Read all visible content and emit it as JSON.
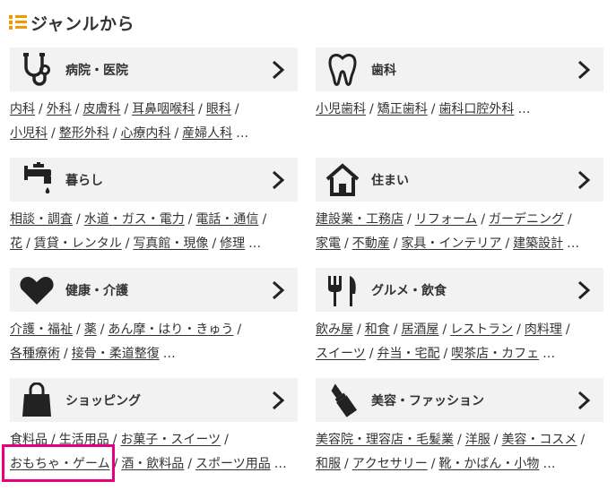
{
  "heading": {
    "title": "ジャンルから",
    "icon": "list-icon",
    "accent": "#f39800"
  },
  "categories": [
    {
      "label": "病院・医院",
      "icon": "stethoscope-icon",
      "line1": [
        {
          "text": "内科"
        },
        {
          "text": "外科"
        },
        {
          "text": "皮膚科"
        },
        {
          "text": "耳鼻咽喉科"
        },
        {
          "text": "眼科"
        }
      ],
      "line2": [
        {
          "text": "小児科"
        },
        {
          "text": "整形外科"
        },
        {
          "text": "心療内科"
        },
        {
          "text": "産婦人科"
        }
      ],
      "more": "…"
    },
    {
      "label": "歯科",
      "icon": "tooth-icon",
      "line1": [
        {
          "text": "小児歯科"
        },
        {
          "text": "矯正歯科"
        },
        {
          "text": "歯科口腔外科"
        }
      ],
      "line2": [],
      "more": "…"
    },
    {
      "label": "暮らし",
      "icon": "faucet-icon",
      "line1": [
        {
          "text": "相談・調査"
        },
        {
          "text": "水道・ガス・電力"
        },
        {
          "text": "電話・通信"
        }
      ],
      "line2": [
        {
          "text": "花"
        },
        {
          "text": "賃貸・レンタル"
        },
        {
          "text": "写真館・現像"
        },
        {
          "text": "修理"
        }
      ],
      "more": "…"
    },
    {
      "label": "住まい",
      "icon": "house-icon",
      "line1": [
        {
          "text": "建設業・工務店"
        },
        {
          "text": "リフォーム"
        },
        {
          "text": "ガーデニング"
        }
      ],
      "line2": [
        {
          "text": "家電"
        },
        {
          "text": "不動産"
        },
        {
          "text": "家具・インテリア"
        },
        {
          "text": "建築設計"
        }
      ],
      "more": "…"
    },
    {
      "label": "健康・介護",
      "icon": "heart-icon",
      "line1": [
        {
          "text": "介護・福祉"
        },
        {
          "text": "薬"
        },
        {
          "text": "あん摩・はり・きゅう"
        }
      ],
      "line2": [
        {
          "text": "各種療術"
        },
        {
          "text": "接骨・柔道整復"
        }
      ],
      "more": "…"
    },
    {
      "label": "グルメ・飲食",
      "icon": "fork-knife-icon",
      "line1": [
        {
          "text": "飲み屋"
        },
        {
          "text": "和食"
        },
        {
          "text": "居酒屋"
        },
        {
          "text": "レストラン"
        },
        {
          "text": "肉料理"
        }
      ],
      "line2": [
        {
          "text": "スイーツ"
        },
        {
          "text": "弁当・宅配"
        },
        {
          "text": "喫茶店・カフェ"
        }
      ],
      "more": "…"
    },
    {
      "label": "ショッピング",
      "icon": "shopping-bag-icon",
      "line1": [
        {
          "text": "食料品"
        },
        {
          "text": "生活用品"
        },
        {
          "text": "お菓子・スイーツ"
        }
      ],
      "line2": [
        {
          "text": "おもちゃ・ゲーム"
        },
        {
          "text": "酒・飲料品"
        },
        {
          "text": "スポーツ用品"
        }
      ],
      "more": "…"
    },
    {
      "label": "美容・ファッション",
      "icon": "lipstick-icon",
      "line1": [
        {
          "text": "美容院・理容店・毛髪業"
        },
        {
          "text": "洋服"
        },
        {
          "text": "美容・コスメ"
        }
      ],
      "line2": [
        {
          "text": "和服"
        },
        {
          "text": "アクセサリー"
        },
        {
          "text": "靴・かばん・小物"
        }
      ],
      "more": "…"
    }
  ],
  "separator": "/",
  "highlight_color": "#e4007f"
}
